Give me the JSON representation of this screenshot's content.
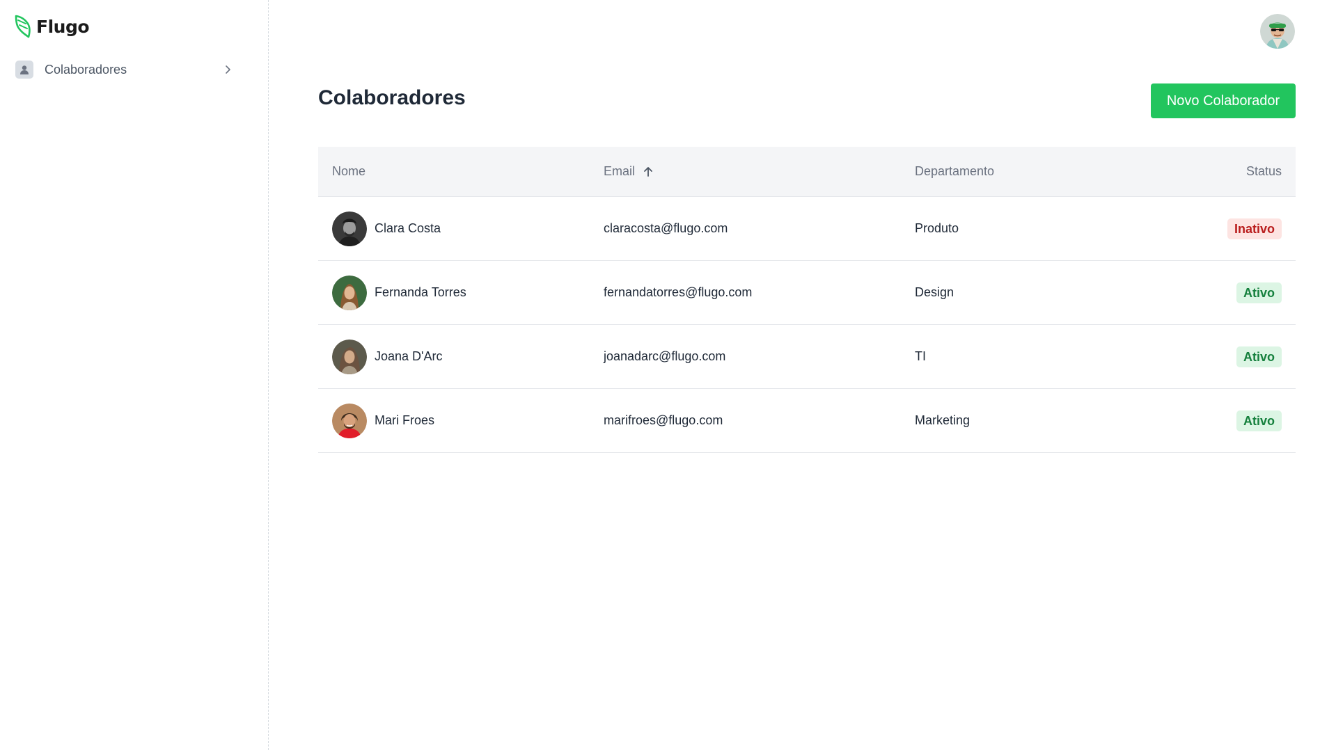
{
  "app": {
    "logo_text": "Flugo",
    "brand_color": "#22c55e"
  },
  "sidebar": {
    "items": [
      {
        "label": "Colaboradores",
        "icon": "user-icon"
      }
    ]
  },
  "header": {
    "user_avatar": "user-avatar-icon"
  },
  "main": {
    "title": "Colaboradores",
    "new_button_label": "Novo Colaborador"
  },
  "table": {
    "columns": {
      "name": "Nome",
      "email": "Email",
      "department": "Departamento",
      "status": "Status"
    },
    "sort": {
      "column": "email",
      "direction": "asc"
    },
    "rows": [
      {
        "name": "Clara Costa",
        "email": "claracosta@flugo.com",
        "department": "Produto",
        "status": "Inativo"
      },
      {
        "name": "Fernanda Torres",
        "email": "fernandatorres@flugo.com",
        "department": "Design",
        "status": "Ativo"
      },
      {
        "name": "Joana D'Arc",
        "email": "joanadarc@flugo.com",
        "department": "TI",
        "status": "Ativo"
      },
      {
        "name": "Mari Froes",
        "email": "marifroes@flugo.com",
        "department": "Marketing",
        "status": "Ativo"
      }
    ]
  },
  "colors": {
    "inactive_bg": "#fde4e2",
    "inactive_text": "#b91c1c",
    "active_bg": "#dcf5e4",
    "active_text": "#15803d"
  }
}
